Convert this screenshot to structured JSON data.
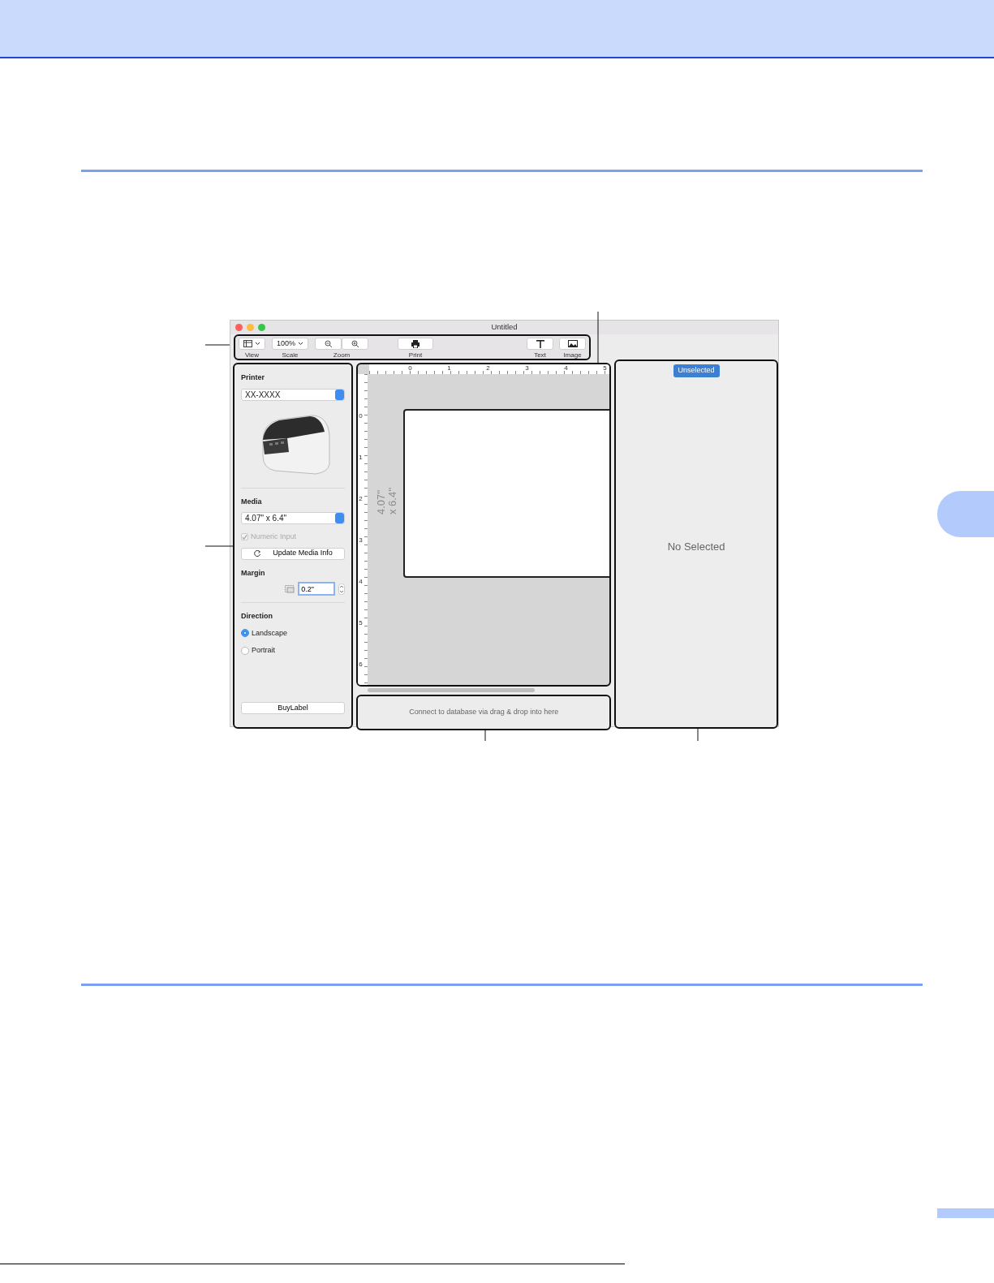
{
  "window": {
    "title": "Untitled"
  },
  "toolbar": {
    "items": [
      {
        "kind": "view",
        "label": "View"
      },
      {
        "kind": "scale",
        "value": "100%",
        "label": "Scale"
      },
      {
        "kind": "zoom",
        "label": "Zoom"
      },
      {
        "kind": "print",
        "label": "Print"
      },
      {
        "kind": "text",
        "label": "Text"
      },
      {
        "kind": "image",
        "label": "Image"
      }
    ]
  },
  "sidebar": {
    "printer": {
      "heading": "Printer",
      "value": "XX-XXXX"
    },
    "media": {
      "heading": "Media",
      "value": "4.07\" x 6.4\""
    },
    "numeric_input": {
      "label": "Numeric Input",
      "checked": true,
      "disabled": true
    },
    "update_button": "Update Media Info",
    "margin": {
      "heading": "Margin",
      "value": "0.2\""
    },
    "direction": {
      "heading": "Direction",
      "options": [
        {
          "label": "Landscape",
          "selected": true
        },
        {
          "label": "Portrait",
          "selected": false
        }
      ]
    },
    "buy_button": "BuyLabel"
  },
  "canvas": {
    "top_ruler": [
      "0",
      "1",
      "2",
      "3",
      "4",
      "5"
    ],
    "left_ruler": [
      "0",
      "1",
      "2",
      "3",
      "4",
      "5",
      "6"
    ],
    "size_label": [
      "4.07''",
      "x 6.4''"
    ]
  },
  "database": {
    "placeholder": "Connect to database via drag & drop into here"
  },
  "inspector": {
    "tab": "Unselected",
    "message": "No Selected"
  }
}
